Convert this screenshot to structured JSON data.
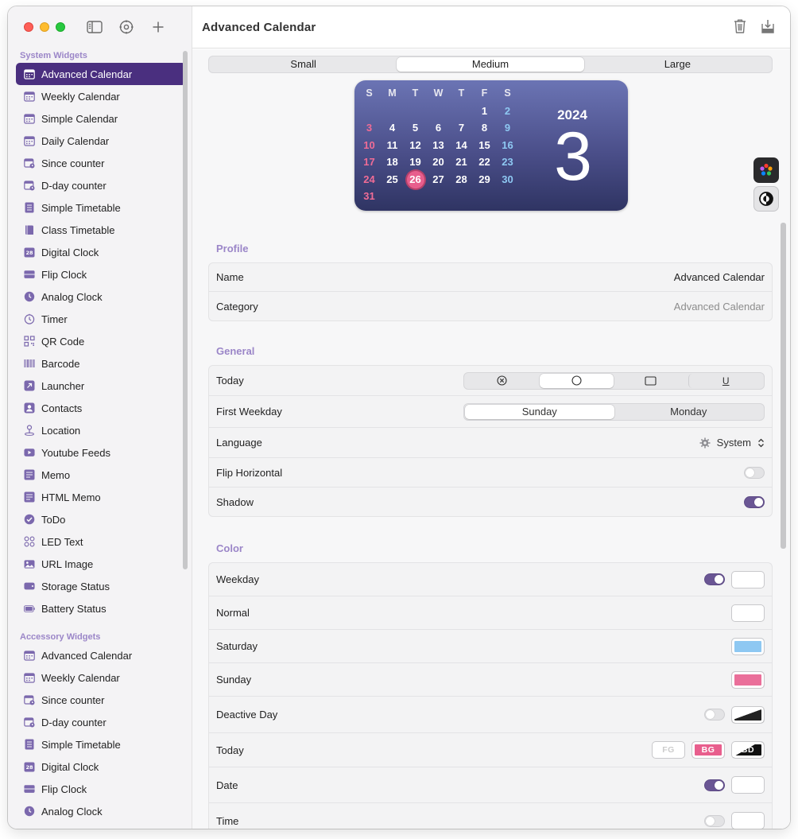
{
  "window": {
    "title": "Advanced Calendar"
  },
  "sidebar": {
    "system_section": "System Widgets",
    "system_items": [
      {
        "label": "Advanced Calendar",
        "icon": "calendar-icon",
        "active": true
      },
      {
        "label": "Weekly Calendar",
        "icon": "calendar-icon"
      },
      {
        "label": "Simple Calendar",
        "icon": "calendar-icon"
      },
      {
        "label": "Daily Calendar",
        "icon": "calendar-icon"
      },
      {
        "label": "Since counter",
        "icon": "counter-icon"
      },
      {
        "label": "D-day counter",
        "icon": "counter-icon"
      },
      {
        "label": "Simple Timetable",
        "icon": "timetable-icon"
      },
      {
        "label": "Class Timetable",
        "icon": "book-icon"
      },
      {
        "label": "Digital Clock",
        "icon": "digital-clock-icon"
      },
      {
        "label": "Flip Clock",
        "icon": "flip-clock-icon"
      },
      {
        "label": "Analog Clock",
        "icon": "clock-icon"
      },
      {
        "label": "Timer",
        "icon": "timer-icon"
      },
      {
        "label": "QR Code",
        "icon": "qr-code-icon"
      },
      {
        "label": "Barcode",
        "icon": "barcode-icon"
      },
      {
        "label": "Launcher",
        "icon": "launcher-icon"
      },
      {
        "label": "Contacts",
        "icon": "contacts-icon"
      },
      {
        "label": "Location",
        "icon": "location-icon"
      },
      {
        "label": "Youtube Feeds",
        "icon": "play-icon"
      },
      {
        "label": "Memo",
        "icon": "memo-icon"
      },
      {
        "label": "HTML Memo",
        "icon": "memo-icon"
      },
      {
        "label": "ToDo",
        "icon": "check-icon"
      },
      {
        "label": "LED Text",
        "icon": "led-icon"
      },
      {
        "label": "URL Image",
        "icon": "image-icon"
      },
      {
        "label": "Storage Status",
        "icon": "storage-icon"
      },
      {
        "label": "Battery Status",
        "icon": "battery-icon"
      }
    ],
    "accessory_section": "Accessory Widgets",
    "accessory_items": [
      {
        "label": "Advanced Calendar",
        "icon": "calendar-icon"
      },
      {
        "label": "Weekly Calendar",
        "icon": "calendar-icon"
      },
      {
        "label": "Since counter",
        "icon": "counter-icon"
      },
      {
        "label": "D-day counter",
        "icon": "counter-icon"
      },
      {
        "label": "Simple Timetable",
        "icon": "timetable-icon"
      },
      {
        "label": "Digital Clock",
        "icon": "digital-clock-icon"
      },
      {
        "label": "Flip Clock",
        "icon": "flip-clock-icon"
      },
      {
        "label": "Analog Clock",
        "icon": "clock-icon"
      }
    ]
  },
  "size_tabs": {
    "small": "Small",
    "medium": "Medium",
    "large": "Large",
    "selected": "Medium"
  },
  "preview": {
    "weekdays": [
      "S",
      "M",
      "T",
      "W",
      "T",
      "F",
      "S"
    ],
    "weeks": [
      [
        "",
        "",
        "",
        "",
        "",
        "1",
        "2"
      ],
      [
        "3",
        "4",
        "5",
        "6",
        "7",
        "8",
        "9"
      ],
      [
        "10",
        "11",
        "12",
        "13",
        "14",
        "15",
        "16"
      ],
      [
        "17",
        "18",
        "19",
        "20",
        "21",
        "22",
        "23"
      ],
      [
        "24",
        "25",
        "26",
        "27",
        "28",
        "29",
        "30"
      ],
      [
        "31",
        "",
        "",
        "",
        "",
        "",
        ""
      ]
    ],
    "today": "26",
    "year": "2024",
    "month": "3",
    "colors": {
      "background_top": "#6b74b4",
      "background_bottom": "#2f3463",
      "sunday": "#f06c96",
      "saturday": "#8ec8f2",
      "today": "#e85e8d"
    }
  },
  "profile": {
    "title": "Profile",
    "name_label": "Name",
    "name_value": "Advanced Calendar",
    "category_label": "Category",
    "category_value": "Advanced Calendar"
  },
  "general": {
    "title": "General",
    "today_label": "Today",
    "today_options": [
      "⊗",
      "◯",
      "▭",
      "U"
    ],
    "today_selected_index": 1,
    "first_weekday_label": "First Weekday",
    "first_weekday_options": [
      "Sunday",
      "Monday"
    ],
    "first_weekday_selected": "Sunday",
    "language_label": "Language",
    "language_value": "System",
    "flip_label": "Flip Horizontal",
    "flip_on": false,
    "shadow_label": "Shadow",
    "shadow_on": true
  },
  "color": {
    "title": "Color",
    "weekday_label": "Weekday",
    "normal_label": "Normal",
    "saturday_label": "Saturday",
    "sunday_label": "Sunday",
    "deactive_label": "Deactive Day",
    "today_label": "Today",
    "today_fg": "FG",
    "today_bg": "BG",
    "today_bd": "BD",
    "date_label": "Date",
    "time_label": "Time",
    "accent": "#6a5694"
  }
}
